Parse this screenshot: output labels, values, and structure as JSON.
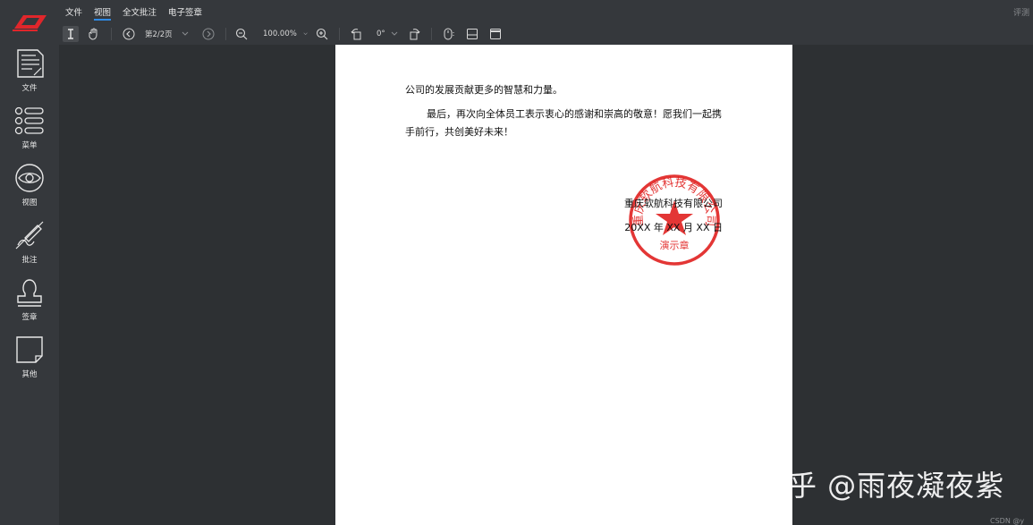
{
  "menu": {
    "items": [
      {
        "label": "文件",
        "active": false
      },
      {
        "label": "视图",
        "active": true
      },
      {
        "label": "全文批注",
        "active": false
      },
      {
        "label": "电子签章",
        "active": false
      }
    ],
    "trial_label": "评测"
  },
  "toolbar": {
    "page_indicator": "第2/2页",
    "zoom": "100.00%",
    "rotation": "0°"
  },
  "sidebar": {
    "items": [
      {
        "label": "文件",
        "icon": "file-icon"
      },
      {
        "label": "菜单",
        "icon": "list-menu-icon"
      },
      {
        "label": "视图",
        "icon": "eye-icon"
      },
      {
        "label": "批注",
        "icon": "pen-annotate-icon"
      },
      {
        "label": "签章",
        "icon": "stamp-icon"
      },
      {
        "label": "其他",
        "icon": "note-icon"
      }
    ]
  },
  "document": {
    "paragraph1": "公司的发展贡献更多的智慧和力量。",
    "paragraph2": "最后，再次向全体员工表示衷心的感谢和崇高的敬意！愿我们一起携手前行，共创美好未来！",
    "company": "重庆软航科技有限公司",
    "date": "20XX 年 XX 月 XX 日",
    "stamp": {
      "text_top": "重庆软航科技有限公司",
      "text_bottom": "演示章",
      "color": "#e0201f"
    }
  },
  "overlay": {
    "watermark": "知乎 @雨夜凝夜紫",
    "csdn": "CSDN @y"
  },
  "colors": {
    "chrome_bg": "#35383c",
    "canvas_bg": "#2d3033",
    "accent": "#2f8be6",
    "logo": "#e0262b"
  }
}
